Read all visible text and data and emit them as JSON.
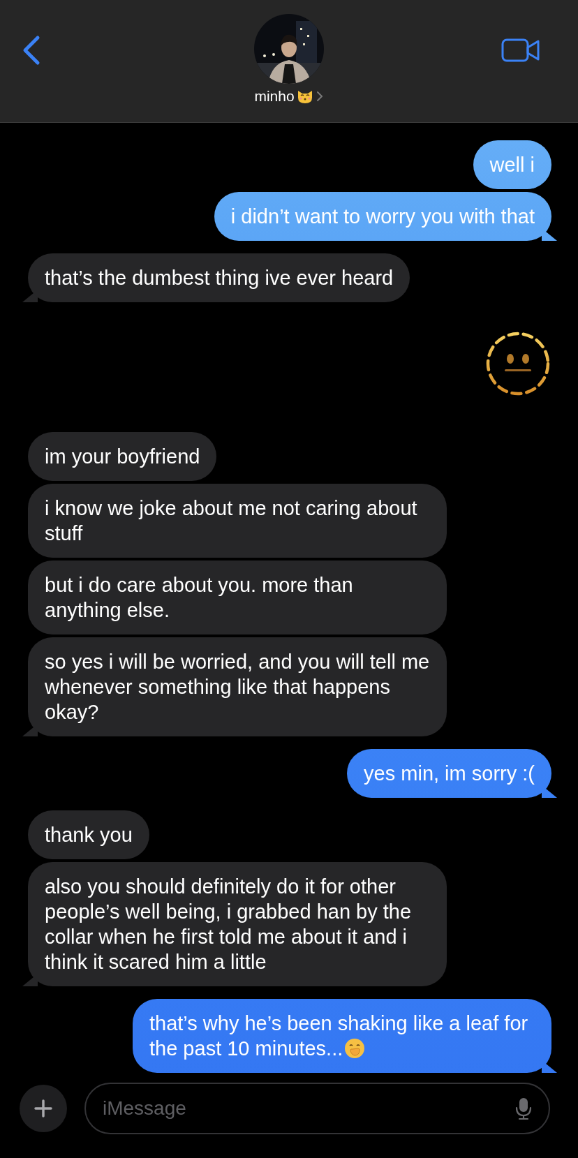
{
  "header": {
    "contact_name": "minho"
  },
  "messages": [
    {
      "kind": "sent",
      "text": "well i",
      "tail": false
    },
    {
      "kind": "sent",
      "text": "i didn’t want to worry you with that",
      "tail": true
    },
    {
      "kind": "received",
      "text": "that’s the dumbest thing ive ever heard",
      "tail": true
    },
    {
      "kind": "emoji"
    },
    {
      "kind": "received",
      "text": "im your boyfriend",
      "tail": false
    },
    {
      "kind": "received",
      "text": "i know we joke about me not caring about stuff",
      "tail": false
    },
    {
      "kind": "received",
      "text": "but i do care about you. more than anything else.",
      "tail": false
    },
    {
      "kind": "received",
      "text": "so yes i will be worried, and you will tell me whenever something like that happens okay?",
      "tail": true
    },
    {
      "kind": "sent",
      "text": "yes min, im sorry :(",
      "tail": true
    },
    {
      "kind": "received",
      "text": "thank you",
      "tail": false
    },
    {
      "kind": "received",
      "text": "also you should definitely do it for other people’s well being, i grabbed han by the collar when he first told me about it and i think it scared him a little",
      "tail": true
    },
    {
      "kind": "sent",
      "text": "that’s why he’s been shaking like a leaf for the past 10 minutes...",
      "emoji": true,
      "tail": true
    }
  ],
  "composer": {
    "placeholder": "iMessage"
  }
}
